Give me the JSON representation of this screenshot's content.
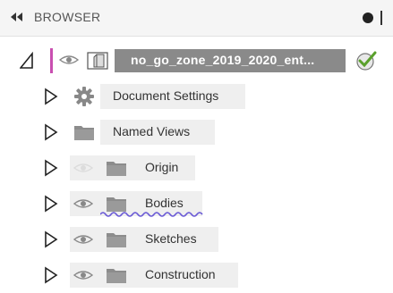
{
  "browser": {
    "title": "BROWSER",
    "root": {
      "label": "no_go_zone_2019_2020_ent..."
    },
    "items": [
      {
        "label": "Document Settings",
        "icon": "gear-icon",
        "visibility": "none"
      },
      {
        "label": "Named Views",
        "icon": "folder-icon",
        "visibility": "none"
      },
      {
        "label": "Origin",
        "icon": "folder-icon",
        "visibility": "hidden"
      },
      {
        "label": "Bodies",
        "icon": "folder-icon",
        "visibility": "visible"
      },
      {
        "label": "Sketches",
        "icon": "folder-icon",
        "visibility": "visible"
      },
      {
        "label": "Construction",
        "icon": "folder-icon",
        "visibility": "visible"
      }
    ]
  },
  "colors": {
    "header_background": "#f5f5f5",
    "root_highlight": "#8a8a8a",
    "root_accent": "#c94fb0",
    "check_green": "#5aa02c",
    "row_background": "#efefef",
    "squiggle": "#6b5bd6"
  }
}
